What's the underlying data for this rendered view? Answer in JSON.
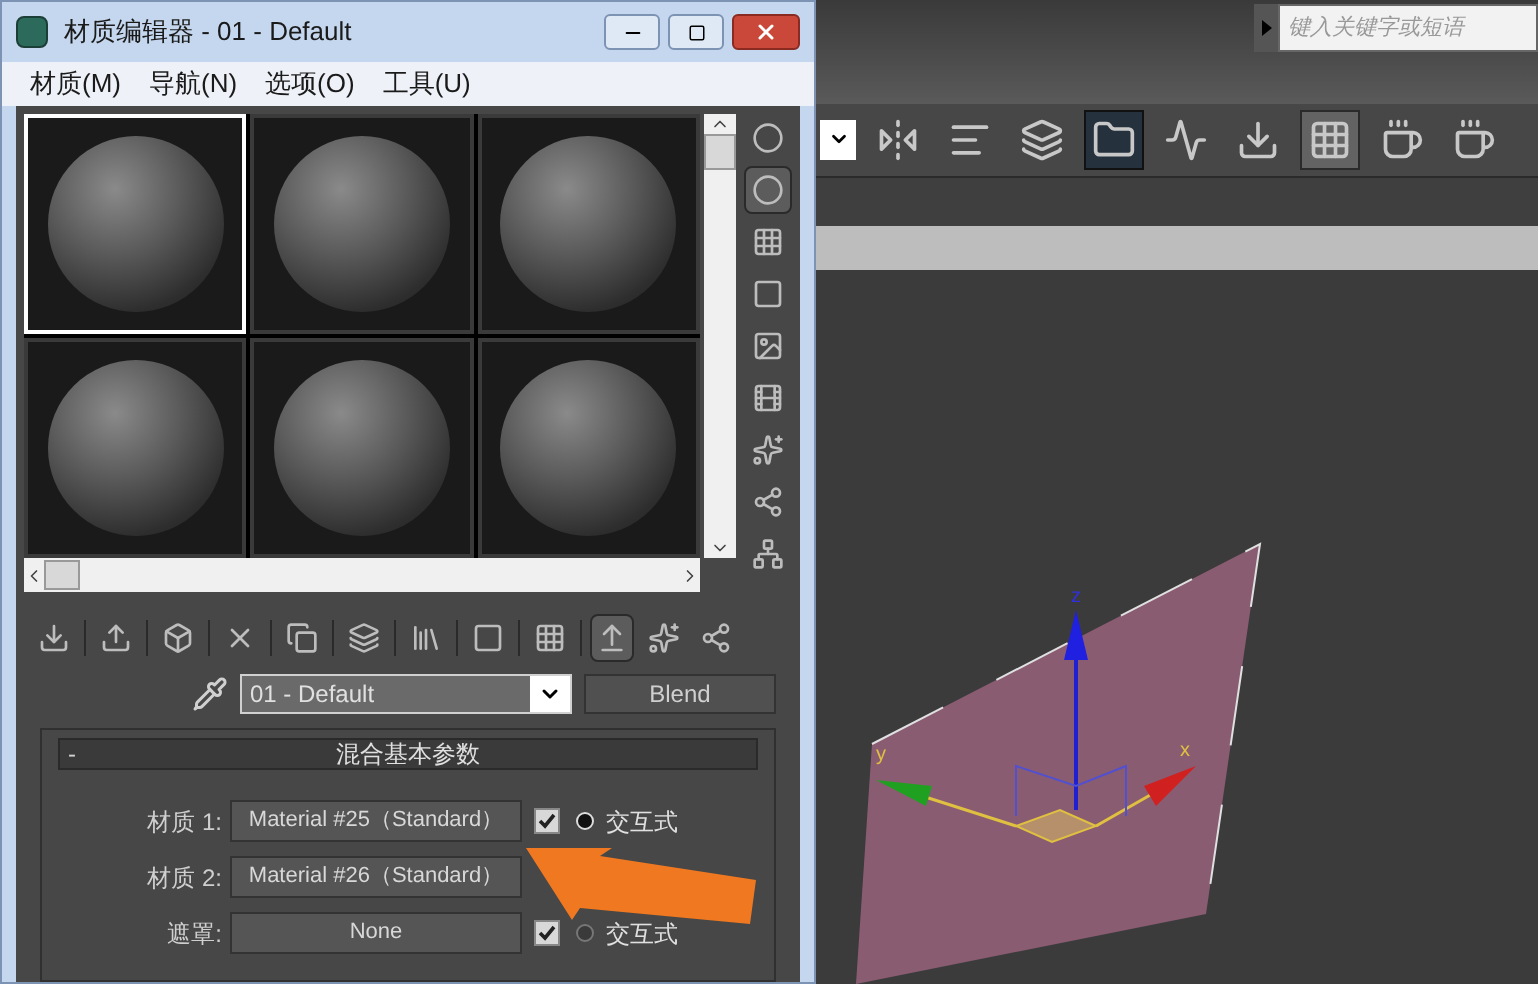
{
  "editor_window": {
    "title": "材质编辑器 - 01 - Default",
    "menu": [
      "材质(M)",
      "导航(N)",
      "选项(O)",
      "工具(U)"
    ],
    "slots": [
      {
        "selected": true
      },
      {
        "selected": false
      },
      {
        "selected": false
      },
      {
        "selected": false
      },
      {
        "selected": false
      },
      {
        "selected": false
      }
    ],
    "side_tools": [
      {
        "kind": "sphere",
        "active": false
      },
      {
        "kind": "backlight",
        "active": true
      },
      {
        "kind": "checker",
        "active": false
      },
      {
        "kind": "square",
        "active": false
      },
      {
        "kind": "gradient",
        "active": false
      },
      {
        "kind": "film",
        "active": false
      },
      {
        "kind": "sphere-check",
        "active": false
      },
      {
        "kind": "sphere-pick",
        "active": false
      },
      {
        "kind": "tree",
        "active": false
      }
    ],
    "bottom_tools": [
      {
        "kind": "get",
        "active": false
      },
      {
        "kind": "put",
        "active": false
      },
      {
        "kind": "assign",
        "active": false
      },
      {
        "kind": "delete",
        "active": false
      },
      {
        "kind": "copy",
        "active": false
      },
      {
        "kind": "unique",
        "active": false
      },
      {
        "kind": "library",
        "active": false
      },
      {
        "kind": "effects",
        "active": false
      },
      {
        "kind": "map",
        "active": false
      },
      {
        "kind": "parent",
        "active": true
      },
      {
        "kind": "up",
        "active": false
      },
      {
        "kind": "next",
        "active": false
      }
    ],
    "material_name": "01 - Default",
    "material_type": "Blend",
    "rollout": {
      "collapse": "-",
      "title": "混合基本参数",
      "rows": [
        {
          "label": "材质 1:",
          "value": "Material #25（Standard）",
          "checked": true,
          "interactive_label": "交互式",
          "interactive": true
        },
        {
          "label": "材质 2:",
          "value": "Material #26（Standard）"
        },
        {
          "label": "遮罩:",
          "value": "None",
          "checked": true,
          "interactive_label": "交互式",
          "interactive": false
        }
      ]
    }
  },
  "search": {
    "placeholder": "键入关键字或短语"
  },
  "main_toolbar": [
    {
      "kind": "dropdown",
      "active": false
    },
    {
      "kind": "mirror",
      "active": false
    },
    {
      "kind": "align",
      "active": false
    },
    {
      "kind": "layers",
      "active": false
    },
    {
      "kind": "folder",
      "active": true
    },
    {
      "kind": "curve",
      "active": false
    },
    {
      "kind": "schematic",
      "active": false
    },
    {
      "kind": "checker",
      "active": true
    },
    {
      "kind": "teapot",
      "active": false
    },
    {
      "kind": "teapot2",
      "active": false
    }
  ],
  "viewport": {
    "axes": [
      "z",
      "y",
      "x"
    ]
  }
}
